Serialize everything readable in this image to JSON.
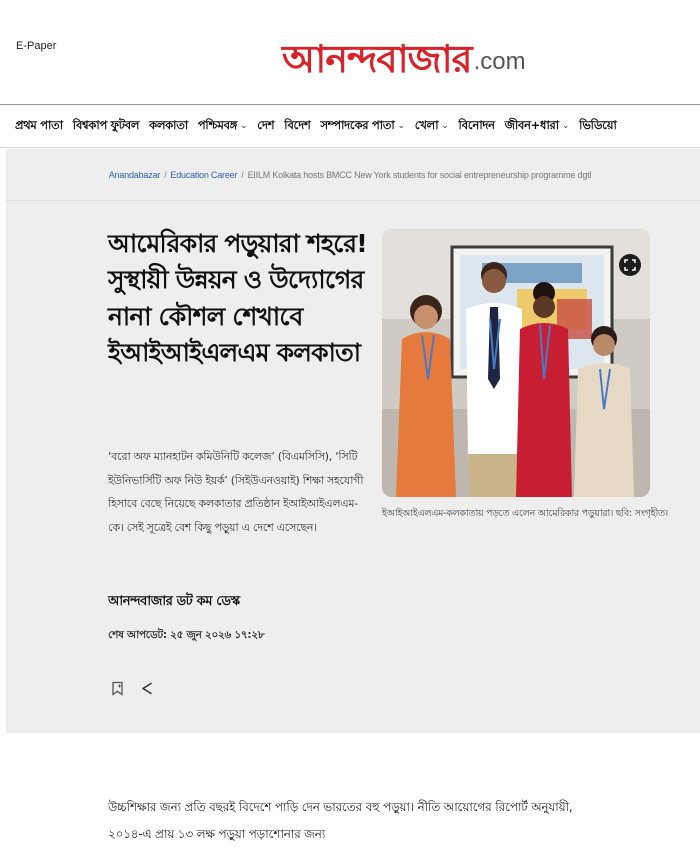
{
  "header": {
    "epaper_label": "E-Paper",
    "logo_main": "আনন্দবাজার",
    "logo_suffix": ".com"
  },
  "nav": {
    "items": [
      {
        "label": "প্রথম পাতা",
        "has_dropdown": false
      },
      {
        "label": "বিশ্বকাপ ফুটবল",
        "has_dropdown": false
      },
      {
        "label": "কলকাতা",
        "has_dropdown": false
      },
      {
        "label": "পশ্চিমবঙ্গ",
        "has_dropdown": true
      },
      {
        "label": "দেশ",
        "has_dropdown": false
      },
      {
        "label": "বিদেশ",
        "has_dropdown": false
      },
      {
        "label": "সম্পাদকের পাতা",
        "has_dropdown": true
      },
      {
        "label": "খেলা",
        "has_dropdown": true
      },
      {
        "label": "বিনোদন",
        "has_dropdown": false
      },
      {
        "label": "জীবন+ধারা",
        "has_dropdown": true
      },
      {
        "label": "ভিডিয়ো",
        "has_dropdown": false
      }
    ]
  },
  "breadcrumb": {
    "items": [
      "Anandabazar",
      "Education Career"
    ],
    "current": "EIILM Kolkata hosts BMCC New York students for social entrepreneurship programme dgtl",
    "separator": "/"
  },
  "article": {
    "headline": "আমেরিকার পড়ুয়ারা শহরে! সুস্থায়ী উন্নয়ন ও উদ্যোগের নানা কৌশল শেখাবে ইআইআইএলএম কলকাতা",
    "summary": "‘বরো অফ ম্যানহাটন কমিউনিটি কলেজ’ (বিএমসিসি), ‘সিটি ইউনিভার্সিটি অফ নিউ ইয়র্ক’ (সিইউএনওয়াই) শিক্ষা সহযোগী হিসাবে বেছে নিয়েছে কলকাতার প্রতিষ্ঠান ইআইআইএলএম-কে। সেই সূত্রেই বেশ কিছু পড়ুয়া এ দেশে এসেছেন।",
    "author": "আনন্দবাজার ডট কম ডেস্ক",
    "updated": "শেষ আপডেট: ২৫ জুন ২০২৬ ১৭:২৮",
    "image_caption": "ইআইআইএলএম-কলকাতায় পড়তে এলেন আমেরিকার পড়ুয়ারা। ছবি: সংগৃহীত।",
    "body_paragraph": "উচ্চশিক্ষার জন্য প্রতি বছরই বিদেশে পাড়ি দেন ভারতের বহু পড়ুয়া। নীতি আয়োগের রিপোর্ট অনুযায়ী, ২০১৪-এ প্রায় ১৩ লক্ষ পড়ুয়া পড়াশোনার জন্য"
  },
  "icons": {
    "bookmark": "bookmark-icon",
    "share": "share-icon",
    "expand": "expand-icon"
  },
  "colors": {
    "brand_red": "#d8232a",
    "panel_gray": "#eeeeee",
    "link_blue": "#2f5ea8"
  }
}
